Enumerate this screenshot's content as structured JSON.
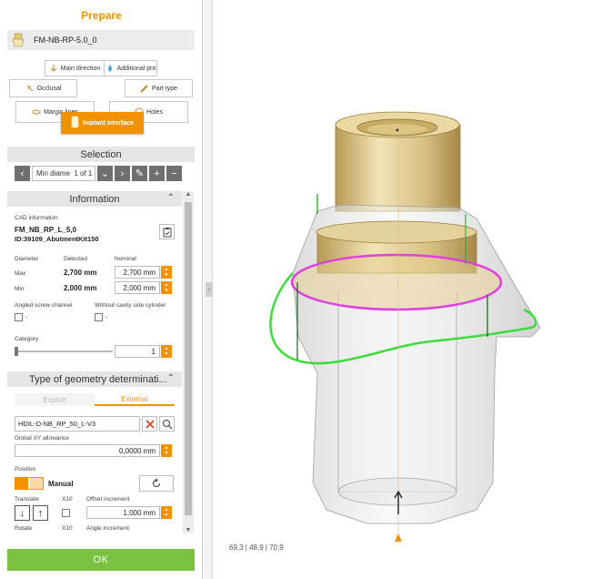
{
  "panel": {
    "title": "Prepare",
    "case_name": "FM-NB-RP-5.0_0",
    "buttons": {
      "main_direction": "Main direction",
      "additional": "Additional pro",
      "occlusal": "Occlusal",
      "part_type": "Part type",
      "margin_lines": "Margin lines",
      "holes": "Holes",
      "implant_interface": "Implant interface"
    }
  },
  "selection": {
    "title": "Selection",
    "filter": "Min diame",
    "count": "1 of 1"
  },
  "information": {
    "title": "Information",
    "cad_label": "CAD information",
    "cad_line1": "FM_NB_RP_L_5,0",
    "cad_line2": "ID:39109_AbutmentKit150",
    "col_diameter": "Diameter",
    "col_detected": "Detected",
    "col_nominal": "Nominal",
    "max_label": "Max",
    "max_detected": "2,700 mm",
    "max_nominal": "2,700  mm",
    "min_label": "Min",
    "min_detected": "2,000 mm",
    "min_nominal": "2,000  mm",
    "angled_label": "Angled screw channel",
    "angled_value": "-",
    "cavity_label": "Without cavity side cylinder",
    "cavity_value": "-",
    "category_label": "Category",
    "category_value": "1"
  },
  "geometry": {
    "title": "Type of geometry determinati...",
    "tab_explicit": "Explicit",
    "tab_external": "External",
    "library_value": "HDIL-D-NB_RP_50_L-V3",
    "xy_label": "Global XY allowance",
    "xy_value": "0,0000  mm",
    "position_label": "Position",
    "position_mode": "Manual",
    "translate_label": "Translate",
    "x10_label": "X10",
    "offset_label": "Offset increment",
    "offset_value": "1,000  mm",
    "rotate_label": "Rotate",
    "x10_label2": "X10",
    "angle_label": "Angle increment"
  },
  "ok_label": "OK",
  "viewport": {
    "coords": "69,3   | 48,9 | 70,9"
  },
  "colors": {
    "accent": "#f39200",
    "ok": "#7bc142",
    "margin_line": "#e040e0",
    "interface_line": "#3ddc3d",
    "abutment": "#e6d39a"
  }
}
